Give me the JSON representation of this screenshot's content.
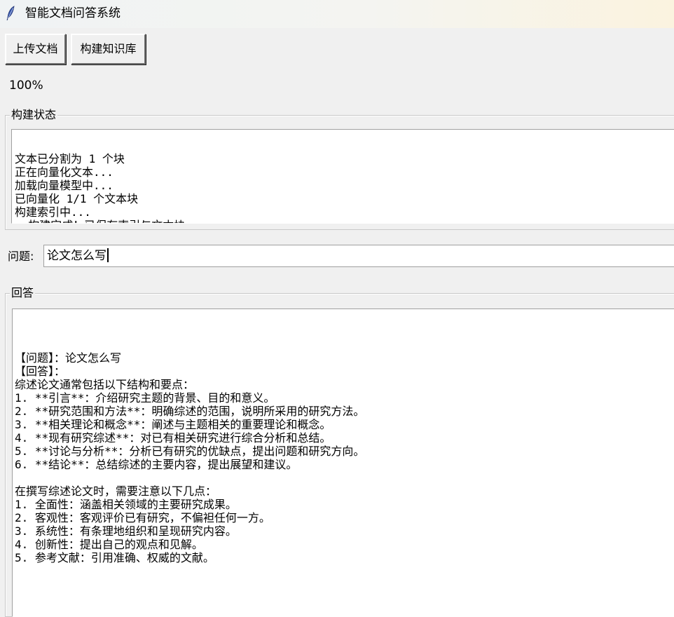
{
  "window": {
    "title": "智能文档问答系统",
    "icon": "feather-icon"
  },
  "toolbar": {
    "upload_label": "上传文档",
    "build_label": "构建知识库"
  },
  "progress": {
    "text": "100%",
    "value": 1.0
  },
  "build_status": {
    "legend": "构建状态",
    "lines": [
      "文本已分割为 1 个块",
      "正在向量化文本...",
      "加载向量模型中...",
      "已向量化 1/1 个文本块",
      "构建索引中...",
      "☑ 构建完成！已保存索引与文本块。"
    ]
  },
  "question": {
    "label": "问题:",
    "value": "论文怎么写"
  },
  "answer": {
    "legend": "回答",
    "lines": [
      "",
      "【问题】：论文怎么写",
      "【回答】：",
      "综述论文通常包括以下结构和要点：",
      "1. **引言**：介绍研究主题的背景、目的和意义。",
      "2. **研究范围和方法**：明确综述的范围，说明所采用的研究方法。",
      "3. **相关理论和概念**：阐述与主题相关的重要理论和概念。",
      "4. **现有研究综述**：对已有相关研究进行综合分析和总结。",
      "5. **讨论与分析**：分析已有研究的优缺点，提出问题和研究方向。",
      "6. **结论**：总结综述的主要内容，提出展望和建议。",
      "",
      "在撰写综述论文时，需要注意以下几点：",
      "1. 全面性：涵盖相关领域的主要研究成果。",
      "2. 客观性：客观评价已有研究，不偏袒任何一方。",
      "3. 系统性：有条理地组织和呈现研究内容。",
      "4. 创新性：提出自己的观点和见解。",
      "5. 参考文献：引用准确、权威的文献。"
    ]
  }
}
